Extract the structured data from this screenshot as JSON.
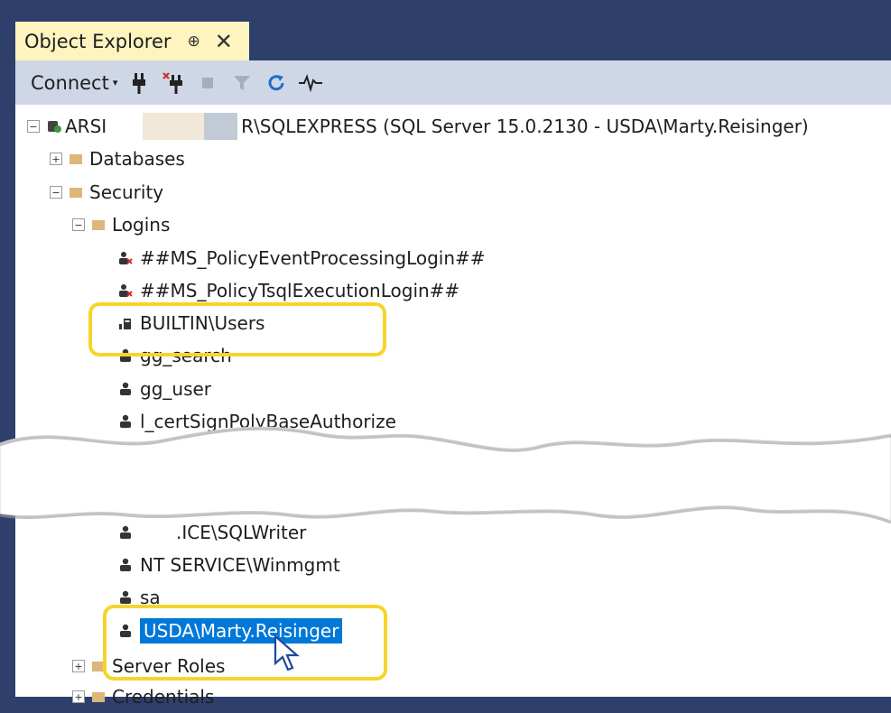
{
  "window": {
    "tab_title": "Object Explorer",
    "pin_glyph": "⊕",
    "close_glyph": "✕"
  },
  "toolbar": {
    "connect_label": "Connect",
    "connect_caret": "▾"
  },
  "tree": {
    "server": {
      "prefix": "ARSI",
      "suffix": "R\\SQLEXPRESS (SQL Server 15.0.2130 - USDA\\Marty.Reisinger)"
    },
    "databases": "Databases",
    "security": "Security",
    "logins": "Logins",
    "login_items": [
      "##MS_PolicyEventProcessingLogin##",
      "##MS_PolicyTsqlExecutionLogin##",
      "BUILTIN\\Users",
      "gg_search",
      "gg_user",
      "l_certSignPolyBaseAuthorize",
      ".ICE\\SQLWriter",
      "NT SERVICE\\Winmgmt",
      "sa",
      "USDA\\Marty.Reisinger"
    ],
    "server_roles": "Server Roles",
    "credentials": "Credentials"
  },
  "colors": {
    "chrome_dark": "#2e3f6c",
    "tab_active": "#fdf4bf",
    "toolbar_bg": "#cfd6e5",
    "selection": "#0078d7",
    "highlight_ring": "#f6d52b",
    "folder": "#dcb67a"
  }
}
